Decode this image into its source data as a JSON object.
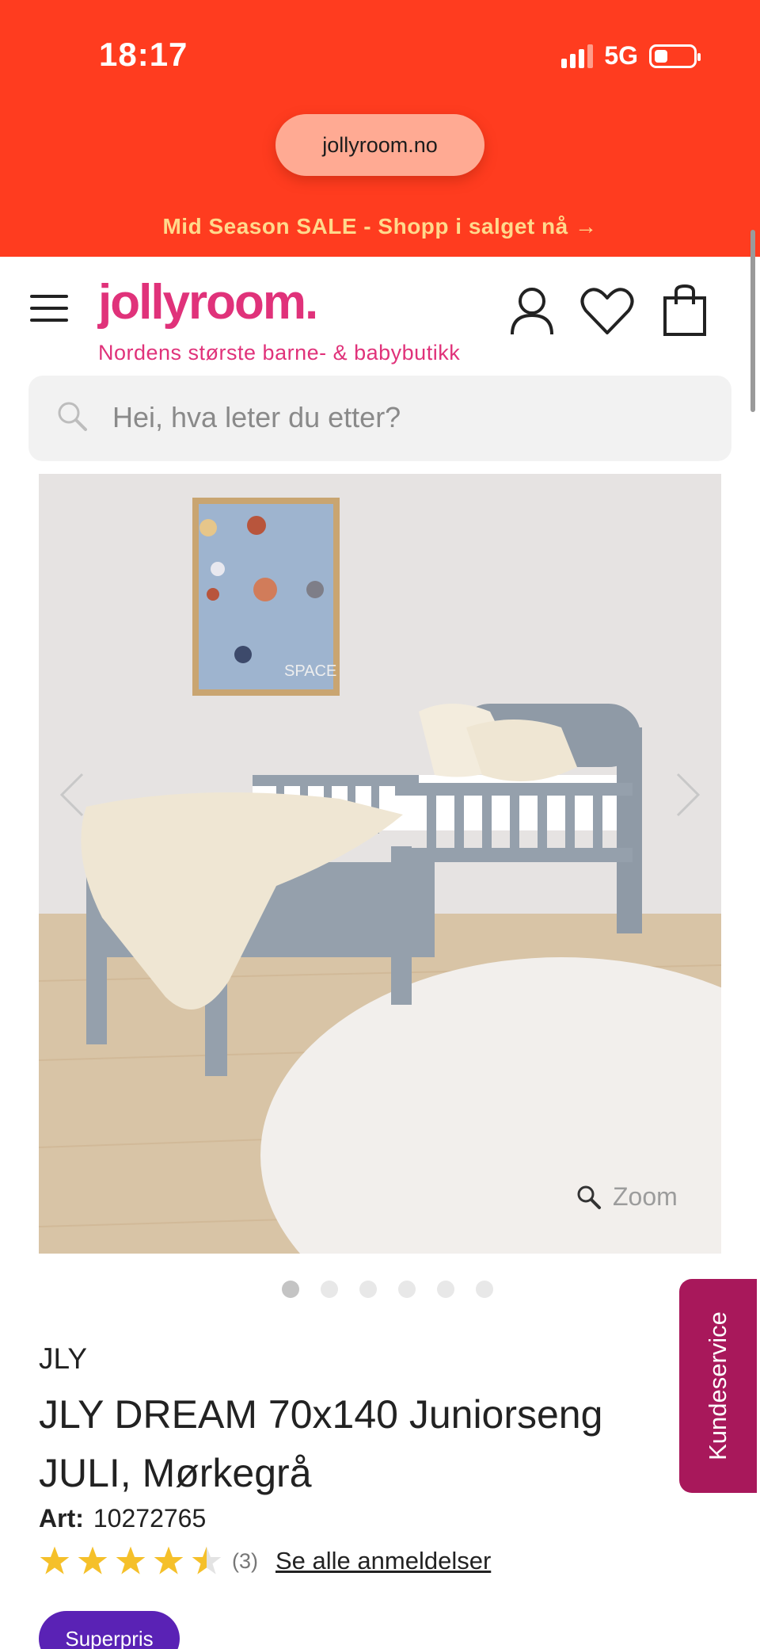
{
  "status_bar": {
    "time": "18:17",
    "network": "5G"
  },
  "browser": {
    "url": "jollyroom.no"
  },
  "promo_banner": {
    "text": "Mid Season SALE - Shopp i salget nå →"
  },
  "header": {
    "logo": "jollyroom.",
    "tagline": "Nordens største barne- & babybutikk",
    "icons": [
      "menu-icon",
      "account-icon",
      "heart-icon",
      "cart-icon"
    ]
  },
  "search": {
    "placeholder": "Hei, hva leter du etter?"
  },
  "gallery": {
    "zoom_label": "Zoom",
    "image_count": 6,
    "active_index": 0,
    "poster_text": "SPACE"
  },
  "side_tab": {
    "label": "Kundeservice"
  },
  "product": {
    "brand": "JLY",
    "title": "JLY DREAM 70x140 Juniorseng JULI, Mørkegrå",
    "art_label": "Art:",
    "art_number": "10272765",
    "rating": 4.5,
    "review_count": "(3)",
    "reviews_link": "Se alle anmeldelser",
    "badge": "Superpris"
  },
  "colors": {
    "header_red": "#ff3c1f",
    "brand_pink": "#e0327a",
    "side_tab": "#a8185b",
    "badge_purple": "#5a22b5",
    "star": "#f5c02a"
  }
}
